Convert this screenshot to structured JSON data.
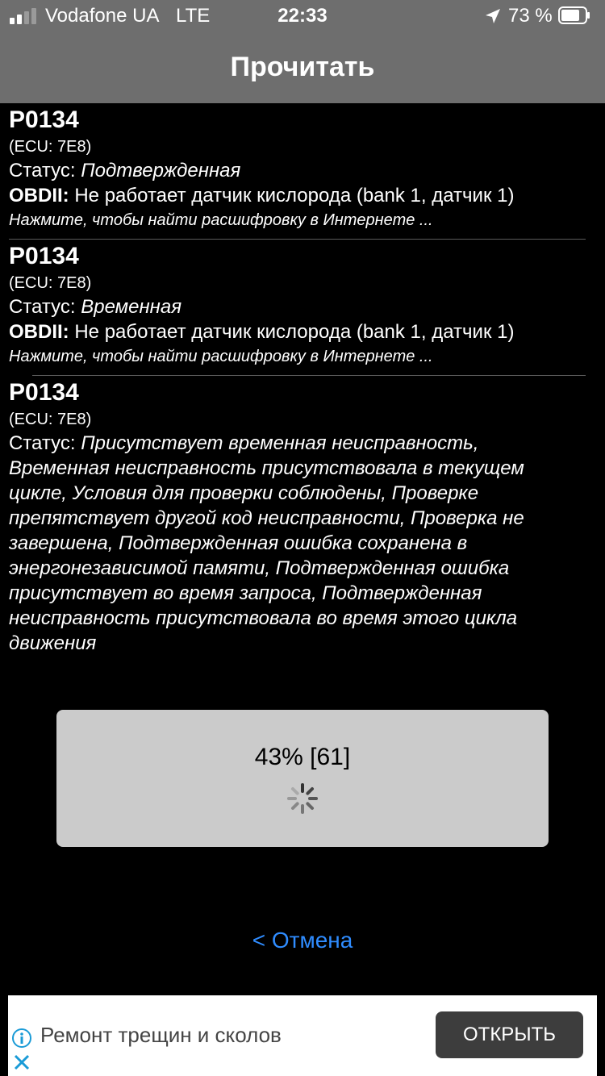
{
  "status_bar": {
    "carrier": "Vodafone UA",
    "network": "LTE",
    "time": "22:33",
    "battery_percent": "73 %",
    "icons": [
      "signal-icon",
      "location-arrow-icon",
      "battery-icon"
    ]
  },
  "nav": {
    "title": "Прочитать"
  },
  "codes": [
    {
      "code": "P0134",
      "ecu": "(ECU: 7E8)",
      "status_label": "Статус:",
      "status_value": "Подтвержденная",
      "obd_label": "OBDII:",
      "obd_text": "Не работает датчик кислорода (bank 1, датчик 1)",
      "hint": "Нажмите, чтобы найти расшифровку в Интернете ..."
    },
    {
      "code": "P0134",
      "ecu": "(ECU: 7E8)",
      "status_label": "Статус:",
      "status_value": "Временная",
      "obd_label": "OBDII:",
      "obd_text": "Не работает датчик кислорода (bank 1, датчик 1)",
      "hint": "Нажмите, чтобы найти расшифровку в Интернете ..."
    },
    {
      "code": "P0134",
      "ecu": "(ECU: 7E8)",
      "status_label": "Статус:",
      "status_value": "Присутствует временная неисправность, Временная неисправность присутствовала в текущем цикле, Условия для проверки соблюдены, Проверке препятствует другой код неисправности, Проверка не завершена, Подтвержденная ошибка сохранена в энергонезависимой памяти, Подтвержденная ошибка присутствует во время запроса, Подтвержденная неисправность присутствовала во время этого цикла движения"
    }
  ],
  "progress": {
    "text": "43% [61]",
    "percent": 43
  },
  "cancel_label": "< Отмена",
  "ad": {
    "text": "Ремонт трещин и сколов",
    "button": "ОТКРЫТЬ"
  },
  "colors": {
    "accent": "#2f8cff",
    "nav_bg": "#6e6e6e",
    "dialog_bg": "#cbcbcb"
  }
}
